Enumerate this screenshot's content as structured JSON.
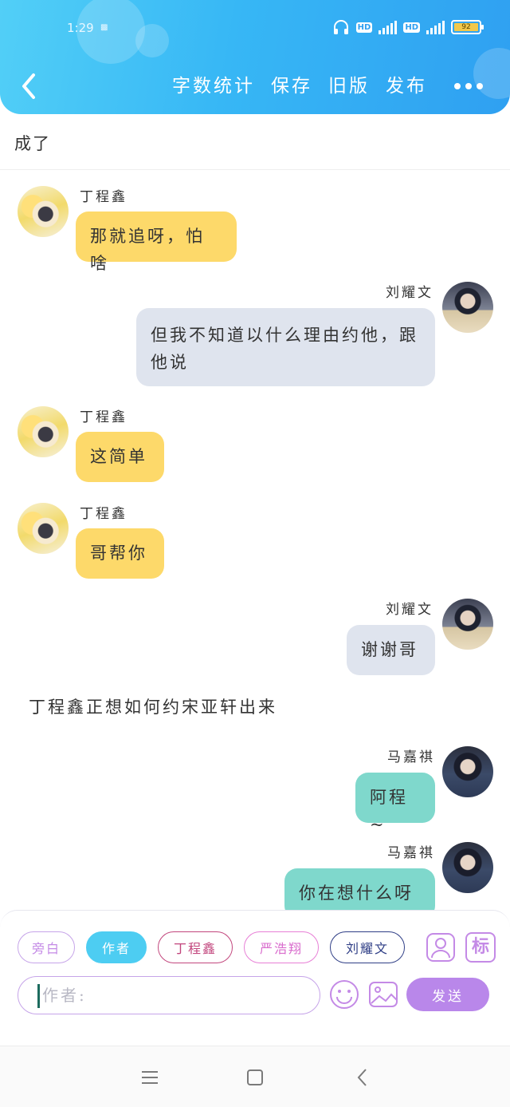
{
  "status_bar": {
    "time": "1:29",
    "indicator": "▩",
    "hd1": "HD",
    "hd2": "HD",
    "battery": "92"
  },
  "header": {
    "actions": [
      "字数统计",
      "保存",
      "旧版",
      "发布"
    ]
  },
  "top_text": "成了",
  "messages": [
    {
      "sender": "丁程鑫",
      "text": "那就追呀，怕啥"
    },
    {
      "sender": "刘耀文",
      "text": "但我不知道以什么理由约他，跟他说"
    },
    {
      "sender": "丁程鑫",
      "text": "这简单"
    },
    {
      "sender": "丁程鑫",
      "text": "哥帮你"
    },
    {
      "sender": "刘耀文",
      "text": "谢谢哥"
    },
    {
      "sender": "马嘉祺",
      "text": "阿程~"
    },
    {
      "sender": "马嘉祺",
      "text": "你在想什么呀"
    }
  ],
  "narration": "丁程鑫正想如何约宋亚轩出来",
  "composer": {
    "roles": [
      "旁白",
      "作者",
      "丁程鑫",
      "严浩翔",
      "刘耀文"
    ],
    "input_placeholder": "作者:",
    "send_label": "发送",
    "tag_label": "标"
  },
  "colors": {
    "header": "#37b7f5",
    "bubble_yellow": "#fdd96a",
    "bubble_gray": "#dfe4ee",
    "bubble_teal": "#7fd8cc",
    "send": "#b987ea"
  }
}
